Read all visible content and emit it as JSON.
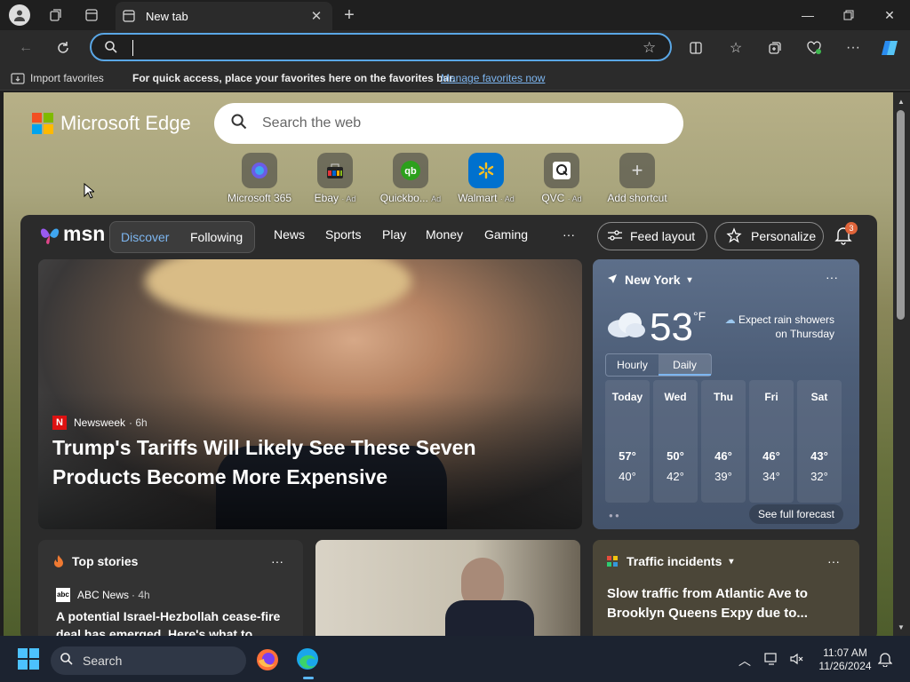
{
  "tab": {
    "title": "New tab"
  },
  "favbar": {
    "import_label": "Import favorites",
    "hint": "For quick access, place your favorites here on the favorites bar.",
    "manage_link": "Manage favorites now"
  },
  "page": {
    "brand": "Microsoft Edge",
    "search_placeholder": "Search the web",
    "shortcuts": [
      {
        "label": "Microsoft 365",
        "ad": ""
      },
      {
        "label": "Ebay",
        "ad": "· Ad"
      },
      {
        "label": "Quickbo...",
        "ad": "Ad"
      },
      {
        "label": "Walmart",
        "ad": "· Ad"
      },
      {
        "label": "QVC",
        "ad": "· Ad"
      },
      {
        "label": "Add shortcut",
        "ad": ""
      }
    ]
  },
  "msn": {
    "logo": "msn",
    "tabs": [
      "Discover",
      "Following"
    ],
    "nav": [
      "News",
      "Sports",
      "Play",
      "Money",
      "Gaming"
    ],
    "more": "···",
    "feed_layout": "Feed layout",
    "personalize": "Personalize",
    "notif_count": "3"
  },
  "hero": {
    "source": "Newsweek",
    "age": "· 6h",
    "headline": "Trump's Tariffs Will Likely See These Seven Products Become More Expensive"
  },
  "weather": {
    "location": "New York",
    "temp": "53",
    "unit": "°F",
    "summary_line1": "Expect rain showers",
    "summary_line2": "on Thursday",
    "tabs": [
      "Hourly",
      "Daily"
    ],
    "days": [
      {
        "day": "Today",
        "high": "57°",
        "low": "40°"
      },
      {
        "day": "Wed",
        "high": "50°",
        "low": "42°"
      },
      {
        "day": "Thu",
        "high": "46°",
        "low": "39°"
      },
      {
        "day": "Fri",
        "high": "46°",
        "low": "34°"
      },
      {
        "day": "Sat",
        "high": "43°",
        "low": "32°"
      }
    ],
    "see_full": "See full forecast"
  },
  "top_stories": {
    "title": "Top stories",
    "source": "ABC News",
    "age": "· 4h",
    "headline": "A potential Israel-Hezbollah cease-fire deal has emerged. Here's what to expect"
  },
  "traffic": {
    "title": "Traffic incidents",
    "headline": "Slow traffic from Atlantic Ave to Brooklyn Queens Expy due to..."
  },
  "taskbar": {
    "search": "Search",
    "time": "11:07 AM",
    "date": "11/26/2024"
  }
}
